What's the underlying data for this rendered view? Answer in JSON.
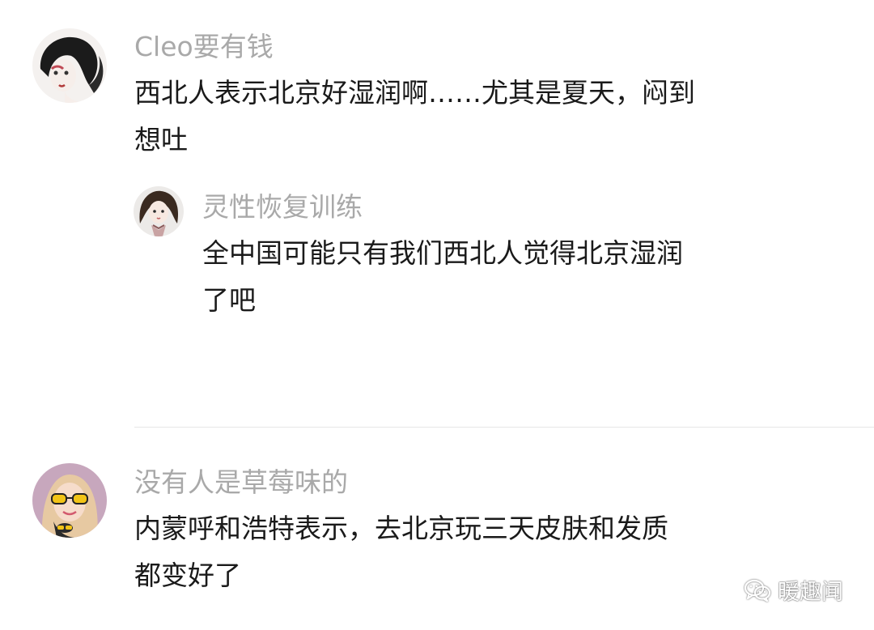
{
  "comments": [
    {
      "username": "Cleo要有钱",
      "lines": [
        "西北人表示北京好湿润啊……尤其是夏天，闷到",
        "想吐"
      ],
      "replies": [
        {
          "username": "灵性恢复训练",
          "lines": [
            "全中国可能只有我们西北人觉得北京湿润",
            "了吧"
          ]
        }
      ]
    },
    {
      "username": "没有人是草莓味的",
      "lines": [
        "内蒙呼和浩特表示，去北京玩三天皮肤和发质",
        "都变好了"
      ]
    }
  ],
  "watermark": {
    "icon": "wechat-icon",
    "text": "暖趣闻"
  },
  "colors": {
    "username": "#a9a9a9",
    "text": "#1a1a1a",
    "divider": "#e6e6e6",
    "background": "#ffffff"
  }
}
